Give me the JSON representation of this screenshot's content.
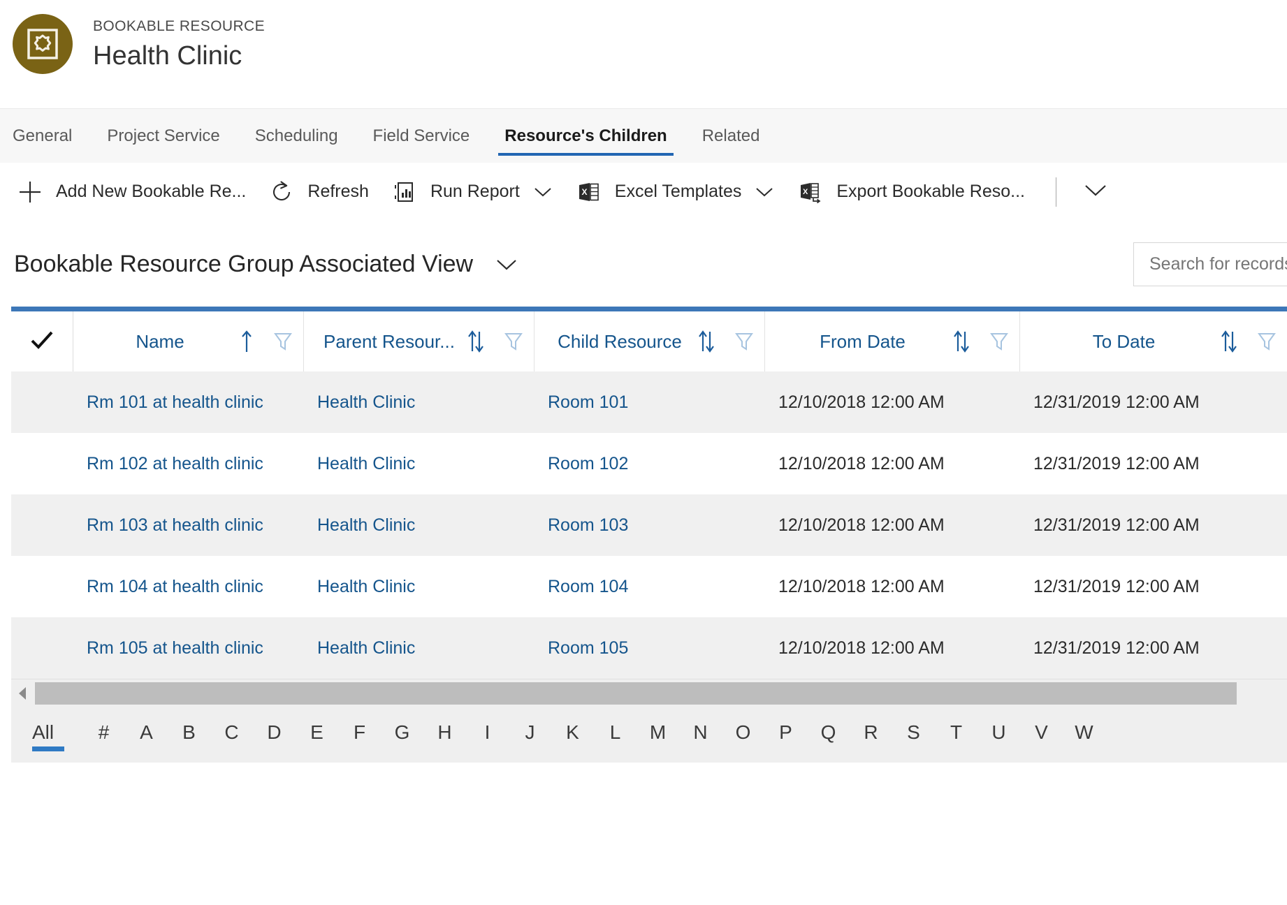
{
  "record_header": {
    "entity_label": "BOOKABLE RESOURCE",
    "title": "Health Clinic",
    "avatar_icon": "bookable-resource-icon",
    "avatar_color": "#7a6315"
  },
  "tabs": [
    {
      "label": "General",
      "active": false
    },
    {
      "label": "Project Service",
      "active": false
    },
    {
      "label": "Scheduling",
      "active": false
    },
    {
      "label": "Field Service",
      "active": false
    },
    {
      "label": "Resource's Children",
      "active": true
    },
    {
      "label": "Related",
      "active": false
    }
  ],
  "command_bar": {
    "items": [
      {
        "label": "Add New Bookable Re...",
        "icon": "plus-icon",
        "caret": false
      },
      {
        "label": "Refresh",
        "icon": "refresh-icon",
        "caret": false
      },
      {
        "label": "Run Report",
        "icon": "report-icon",
        "caret": true
      },
      {
        "label": "Excel Templates",
        "icon": "excel-icon",
        "caret": true
      },
      {
        "label": "Export Bookable Reso...",
        "icon": "excel-export-icon",
        "caret": false
      }
    ],
    "overflow_icon": "chevron-down-icon"
  },
  "view": {
    "title": "Bookable Resource Group Associated View",
    "caret_icon": "chevron-down-icon"
  },
  "search": {
    "placeholder": "Search for records",
    "value": ""
  },
  "grid": {
    "accent_color": "#3d77b8",
    "select_all_icon": "checkmark-icon",
    "columns": [
      {
        "label": "Name",
        "sort": "asc",
        "sort_icon": "sort-ascending-icon",
        "filter_icon": "filter-icon"
      },
      {
        "label": "Parent Resour...",
        "sort": "none",
        "sort_icon": "sort-updown-icon",
        "filter_icon": "filter-icon"
      },
      {
        "label": "Child Resource",
        "sort": "none",
        "sort_icon": "sort-updown-icon",
        "filter_icon": "filter-icon"
      },
      {
        "label": "From Date",
        "sort": "none",
        "sort_icon": "sort-updown-icon",
        "filter_icon": "filter-icon"
      },
      {
        "label": "To Date",
        "sort": "none",
        "sort_icon": "sort-updown-icon",
        "filter_icon": "filter-icon"
      }
    ],
    "rows": [
      {
        "name": "Rm 101 at health clinic",
        "parent_resource": "Health Clinic",
        "child_resource": "Room 101",
        "from_date": "12/10/2018 12:00 AM",
        "to_date": "12/31/2019 12:00 AM"
      },
      {
        "name": "Rm 102 at health clinic",
        "parent_resource": "Health Clinic",
        "child_resource": "Room 102",
        "from_date": "12/10/2018 12:00 AM",
        "to_date": "12/31/2019 12:00 AM"
      },
      {
        "name": "Rm 103 at health clinic",
        "parent_resource": "Health Clinic",
        "child_resource": "Room 103",
        "from_date": "12/10/2018 12:00 AM",
        "to_date": "12/31/2019 12:00 AM"
      },
      {
        "name": "Rm 104 at health clinic",
        "parent_resource": "Health Clinic",
        "child_resource": "Room 104",
        "from_date": "12/10/2018 12:00 AM",
        "to_date": "12/31/2019 12:00 AM"
      },
      {
        "name": "Rm 105 at health clinic",
        "parent_resource": "Health Clinic",
        "child_resource": "Room 105",
        "from_date": "12/10/2018 12:00 AM",
        "to_date": "12/31/2019 12:00 AM"
      }
    ]
  },
  "alpha_index": {
    "items": [
      "All",
      "#",
      "A",
      "B",
      "C",
      "D",
      "E",
      "F",
      "G",
      "H",
      "I",
      "J",
      "K",
      "L",
      "M",
      "N",
      "O",
      "P",
      "Q",
      "R",
      "S",
      "T",
      "U",
      "V",
      "W"
    ],
    "active": "All",
    "active_color": "#2f7ac4"
  },
  "scrollbar": {
    "left_arrow_icon": "triangle-left-icon"
  }
}
